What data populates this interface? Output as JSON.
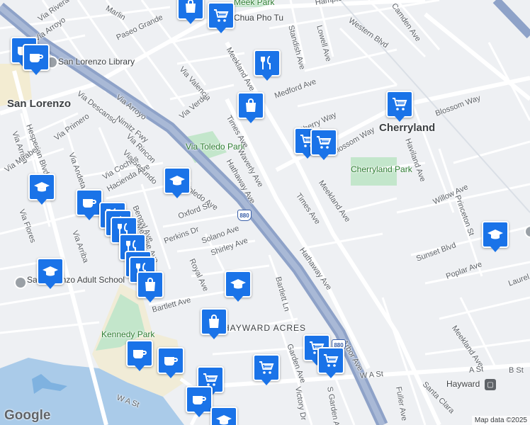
{
  "map": {
    "attribution": "Map data ©2025",
    "logo": "Google",
    "colors": {
      "background": "#eef0f3",
      "road": "#ffffff",
      "highway": "#8ea2c8",
      "water": "#aacbe9",
      "park": "#c3e6cb",
      "school": "#f1ecd7",
      "pin": "#1a73e8"
    }
  },
  "places": {
    "city_san_lorenzo": "San Lorenzo",
    "city_cherryland": "Cherryland",
    "city_hayward": "Hayward",
    "library": "San Lorenzo Library",
    "school": "San Lorenzo Adult School",
    "park_via_toledo": "Via Toledo Park",
    "park_cherryland": "Cherryland Park",
    "park_kennedy": "Kennedy Park",
    "park_meek": "Meek Park",
    "restaurant": "Chua Pho Tu",
    "area_hayward_acres": "HAYWARD ACRES"
  },
  "roads": {
    "nimitz": "Nimitz Fwy",
    "shield_880_a": "880",
    "shield_880_b": "880",
    "hesperian": "Hesperian Blvd",
    "meekland_1": "Meekland Ave",
    "meekland_2": "Meekland Ave",
    "meekland_3": "Meekland Ave",
    "hathaway_1": "Hathaway Ave",
    "hathaway_2": "Hathaway Ave",
    "times_1": "Times Ave",
    "times_2": "Times Ave",
    "waverly": "Waverly Ave",
    "blossom_1": "Blossom Way",
    "blossom_2": "Blossom Way",
    "cherry": "Cherry Way",
    "medford": "Medford Ave",
    "standish": "Standish Ave",
    "lowell": "Lowell Ave",
    "western": "Western Blvd",
    "hampton": "Hampton Rd",
    "camden": "Camden Ave",
    "paseo_grande": "Paseo Grande",
    "marlin": "Marlin",
    "via_rivera": "Via Rivera",
    "via_arroyo_1": "Via Arroyo",
    "via_arroyo_2": "Via Arroyo",
    "via_valencia": "Via Valencia",
    "via_verde": "Via Verde",
    "via_descanso": "Via Descanso",
    "via_primero": "Via Primero",
    "via_arriba_1": "Via Arriba",
    "via_arriba_2": "Via Arriba",
    "via_andeta": "Via Andeta",
    "via_mirabel": "Via Mirabel",
    "via_rincon": "Via Rincon",
    "via_segundo": "Via Segundo",
    "via_coches": "Via Coches",
    "via_flores": "Via Flores",
    "hacienda": "Hacienda Ave",
    "toledo": "Toledo Ave",
    "bengal": "Bengal Ave",
    "melrose": "Melrose Ave",
    "oxford": "Oxford St",
    "perkins": "Perkins Dr",
    "solano": "Solano Ave",
    "royal": "Royal Ave",
    "shirley": "Shirley Ave",
    "bartlett_ln": "Bartlett Ln",
    "bartlett_ave": "Bartlett Ave",
    "garden": "Garden Ave",
    "s_garden": "S Garden Ave",
    "victory": "Victory Dr",
    "arbor": "Arbor Ave",
    "wa_st_1": "W A St",
    "wa_st_2": "W A St",
    "a_st": "A St",
    "b_st": "B St",
    "fuller": "Fuller Ave",
    "santa_clara": "Santa Clara",
    "haviland": "Haviland Ave",
    "willow": "Willow Ave",
    "princeton": "Princeton St",
    "sunset": "Sunset Blvd",
    "poplar": "Poplar Ave",
    "laurel": "Laurel"
  }
}
